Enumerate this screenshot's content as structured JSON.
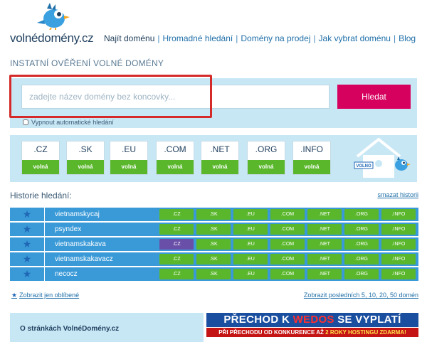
{
  "header": {
    "logo_text": "volnédomény.cz",
    "nav": [
      "Najít doménu",
      "Hromadné hledání",
      "Domény na prodej",
      "Jak vybrat doménu",
      "Blog"
    ]
  },
  "search": {
    "section_title": "INSTATNÍ OVĚŘENÍ VOLNÉ DOMÉNY",
    "placeholder": "zadejte název domény bez koncovky...",
    "button_label": "Hledat",
    "auto_search_label": "Vypnout automatické hledání"
  },
  "tlds": [
    {
      "name": ".CZ",
      "status": "volná"
    },
    {
      "name": ".SK",
      "status": "volná"
    },
    {
      "name": ".EU",
      "status": "volná"
    },
    {
      "name": ".COM",
      "status": "volná"
    },
    {
      "name": ".NET",
      "status": "volná"
    },
    {
      "name": ".ORG",
      "status": "volná"
    },
    {
      "name": ".INFO",
      "status": "volná"
    }
  ],
  "house_sign": "VOLNO",
  "history": {
    "title": "Historie hledání:",
    "clear_label": "smazat historii",
    "tld_labels": [
      ".CZ",
      ".SK",
      ".EU",
      ".COM",
      ".NET",
      ".ORG",
      ".INFO"
    ],
    "rows": [
      {
        "name": "vietnamskycaj",
        "taken": []
      },
      {
        "name": "psyndex",
        "taken": []
      },
      {
        "name": "vietnamskakava",
        "taken": [
          0
        ]
      },
      {
        "name": "vietnamskakavacz",
        "taken": []
      },
      {
        "name": "necocz",
        "taken": []
      }
    ],
    "favorites_label": "Zobrazit jen oblíbené",
    "recent_label": "Zobrazit posledních 5, 10, 20, 50 domén"
  },
  "about": {
    "title": "O stránkách VolnéDomény.cz"
  },
  "ad": {
    "head_pre": "PŘECHOD K ",
    "head_brand": "WEDOS",
    "head_post": " SE VYPLATÍ",
    "sub_pre": "PŘI PŘECHODU OD KONKURENCE AŽ ",
    "sub_highlight": "2 ROKY HOSTINGU ZDARMA!"
  },
  "colors": {
    "accent_button": "#d6005e",
    "free_green": "#5ab72c",
    "taken_purple": "#6a4fa8",
    "panel_blue": "#c8e7f5",
    "row_blue": "#3a9ad8"
  }
}
